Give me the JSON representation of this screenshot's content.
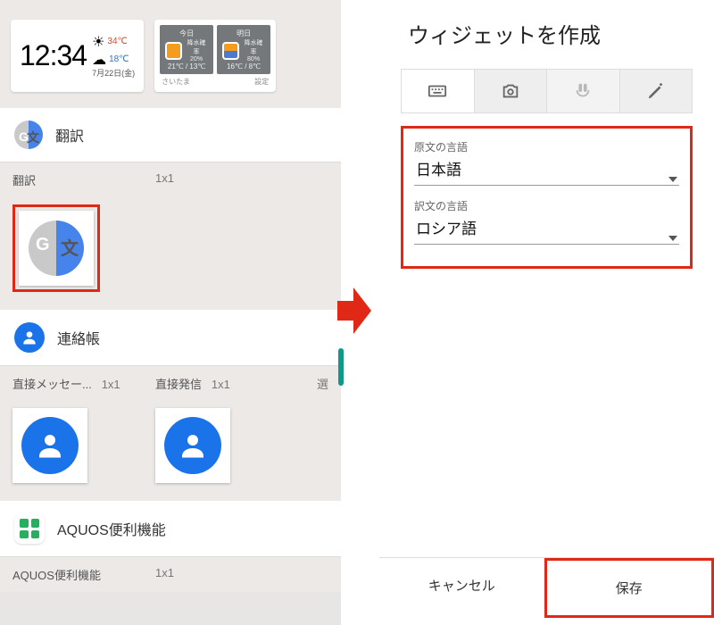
{
  "left": {
    "clock": {
      "time": "12:34",
      "temp_hi": "34℃",
      "temp_lo": "18℃",
      "date": "7月22日(金)"
    },
    "weather": {
      "today_label": "今日",
      "tomorrow_label": "明日",
      "today_pop_label": "降水確率",
      "today_pop": "20%",
      "tomorrow_pop_label": "降水確率",
      "tomorrow_pop": "80%",
      "today_temps": "21℃ / 13℃",
      "tomorrow_temps": "16℃ / 8℃",
      "location": "さいたま",
      "settings": "設定"
    },
    "translate_head": "翻訳",
    "translate_sub_name": "翻訳",
    "translate_sub_size": "1x1",
    "contacts_head": "連絡帳",
    "dm_name": "直接メッセー...",
    "dm_size": "1x1",
    "dc_name": "直接発信",
    "dc_size": "1x1",
    "cutoff": "選",
    "aquos_head": "AQUOS便利機能",
    "aquos_sub_name": "AQUOS便利機能",
    "aquos_sub_size": "1x1"
  },
  "right": {
    "title": "ウィジェットを作成",
    "src_label": "原文の言語",
    "src_val": "日本語",
    "dst_label": "訳文の言語",
    "dst_val": "ロシア語",
    "cancel": "キャンセル",
    "save": "保存"
  }
}
